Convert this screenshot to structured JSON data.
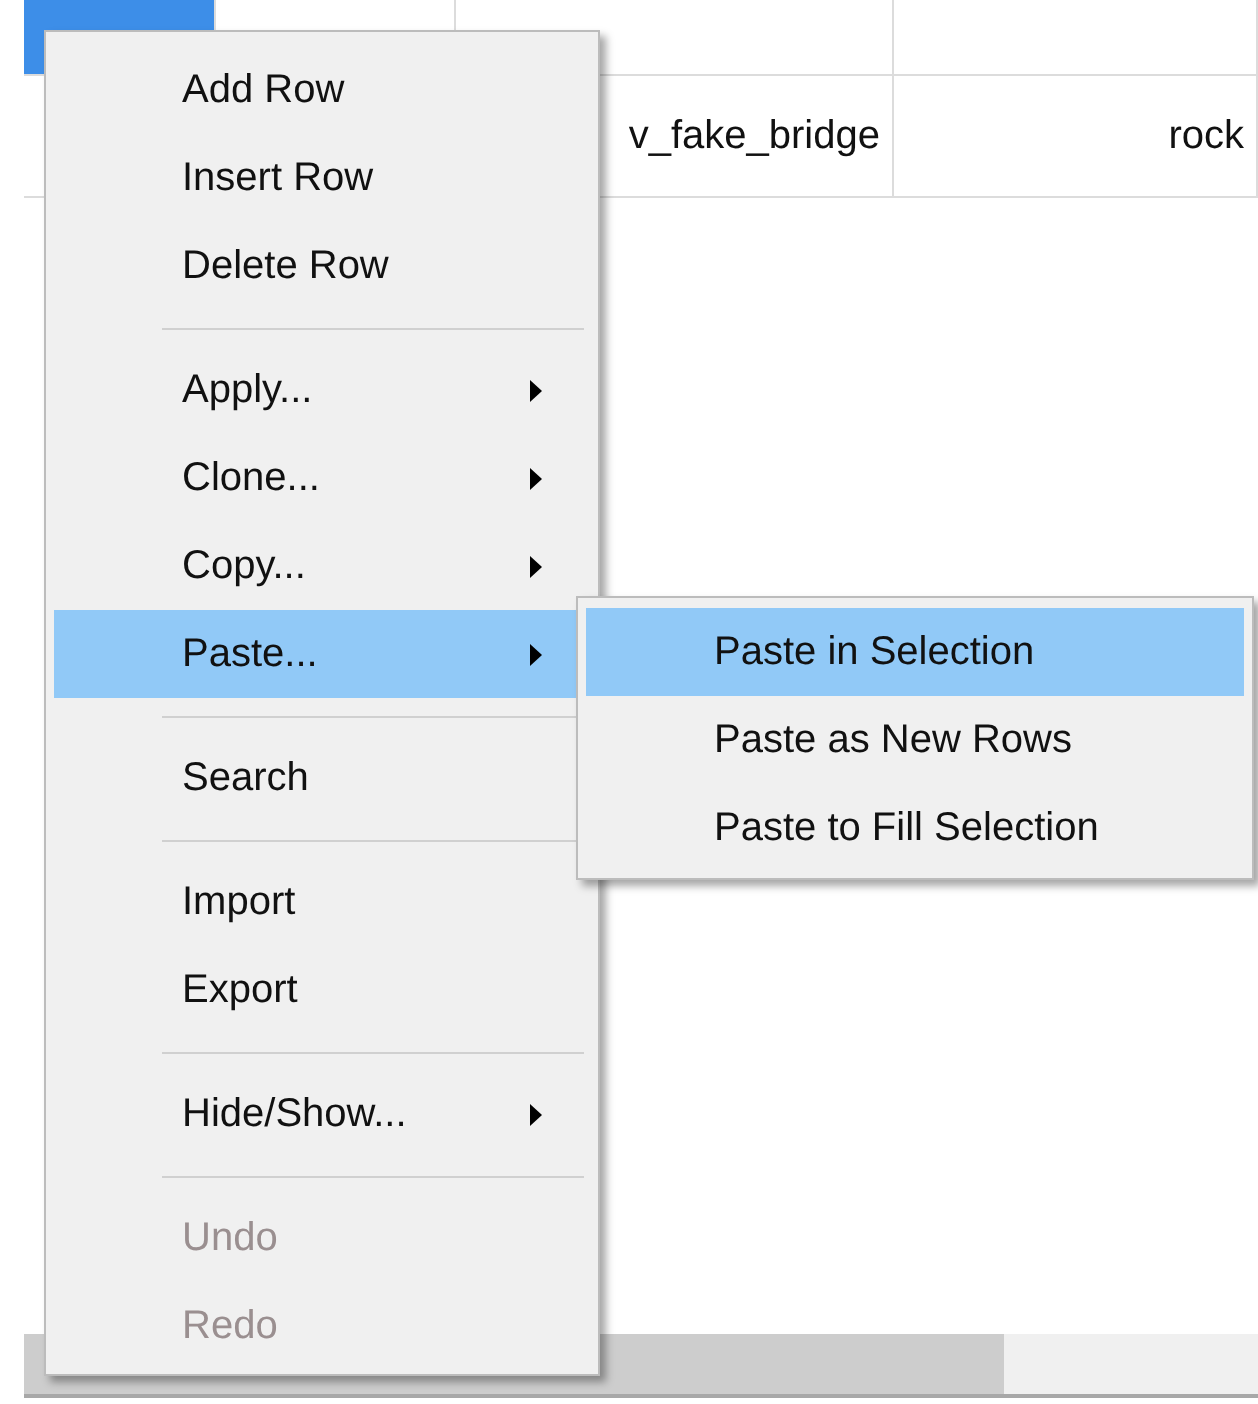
{
  "table": {
    "rows": [
      {
        "selected": true
      },
      {
        "selected": false,
        "column_3": "v_fake_bridge",
        "column_4": "rock"
      }
    ]
  },
  "context_menu": {
    "items": [
      {
        "kind": "item",
        "label": "Add Row",
        "submenu": false,
        "disabled": false,
        "selected": false
      },
      {
        "kind": "item",
        "label": "Insert Row",
        "submenu": false,
        "disabled": false,
        "selected": false
      },
      {
        "kind": "item",
        "label": "Delete Row",
        "submenu": false,
        "disabled": false,
        "selected": false
      },
      {
        "kind": "separator"
      },
      {
        "kind": "item",
        "label": "Apply...",
        "submenu": true,
        "disabled": false,
        "selected": false
      },
      {
        "kind": "item",
        "label": "Clone...",
        "submenu": true,
        "disabled": false,
        "selected": false
      },
      {
        "kind": "item",
        "label": "Copy...",
        "submenu": true,
        "disabled": false,
        "selected": false
      },
      {
        "kind": "item",
        "label": "Paste...",
        "submenu": true,
        "disabled": false,
        "selected": true
      },
      {
        "kind": "separator"
      },
      {
        "kind": "item",
        "label": "Search",
        "submenu": false,
        "disabled": false,
        "selected": false
      },
      {
        "kind": "separator"
      },
      {
        "kind": "item",
        "label": "Import",
        "submenu": false,
        "disabled": false,
        "selected": false
      },
      {
        "kind": "item",
        "label": "Export",
        "submenu": false,
        "disabled": false,
        "selected": false
      },
      {
        "kind": "separator"
      },
      {
        "kind": "item",
        "label": "Hide/Show...",
        "submenu": true,
        "disabled": false,
        "selected": false
      },
      {
        "kind": "separator"
      },
      {
        "kind": "item",
        "label": "Undo",
        "submenu": false,
        "disabled": true,
        "selected": false
      },
      {
        "kind": "item",
        "label": "Redo",
        "submenu": false,
        "disabled": true,
        "selected": false
      }
    ]
  },
  "submenu": {
    "items": [
      {
        "label": "Paste in Selection",
        "selected": true
      },
      {
        "label": "Paste as New Rows",
        "selected": false
      },
      {
        "label": "Paste to Fill Selection",
        "selected": false
      }
    ]
  }
}
